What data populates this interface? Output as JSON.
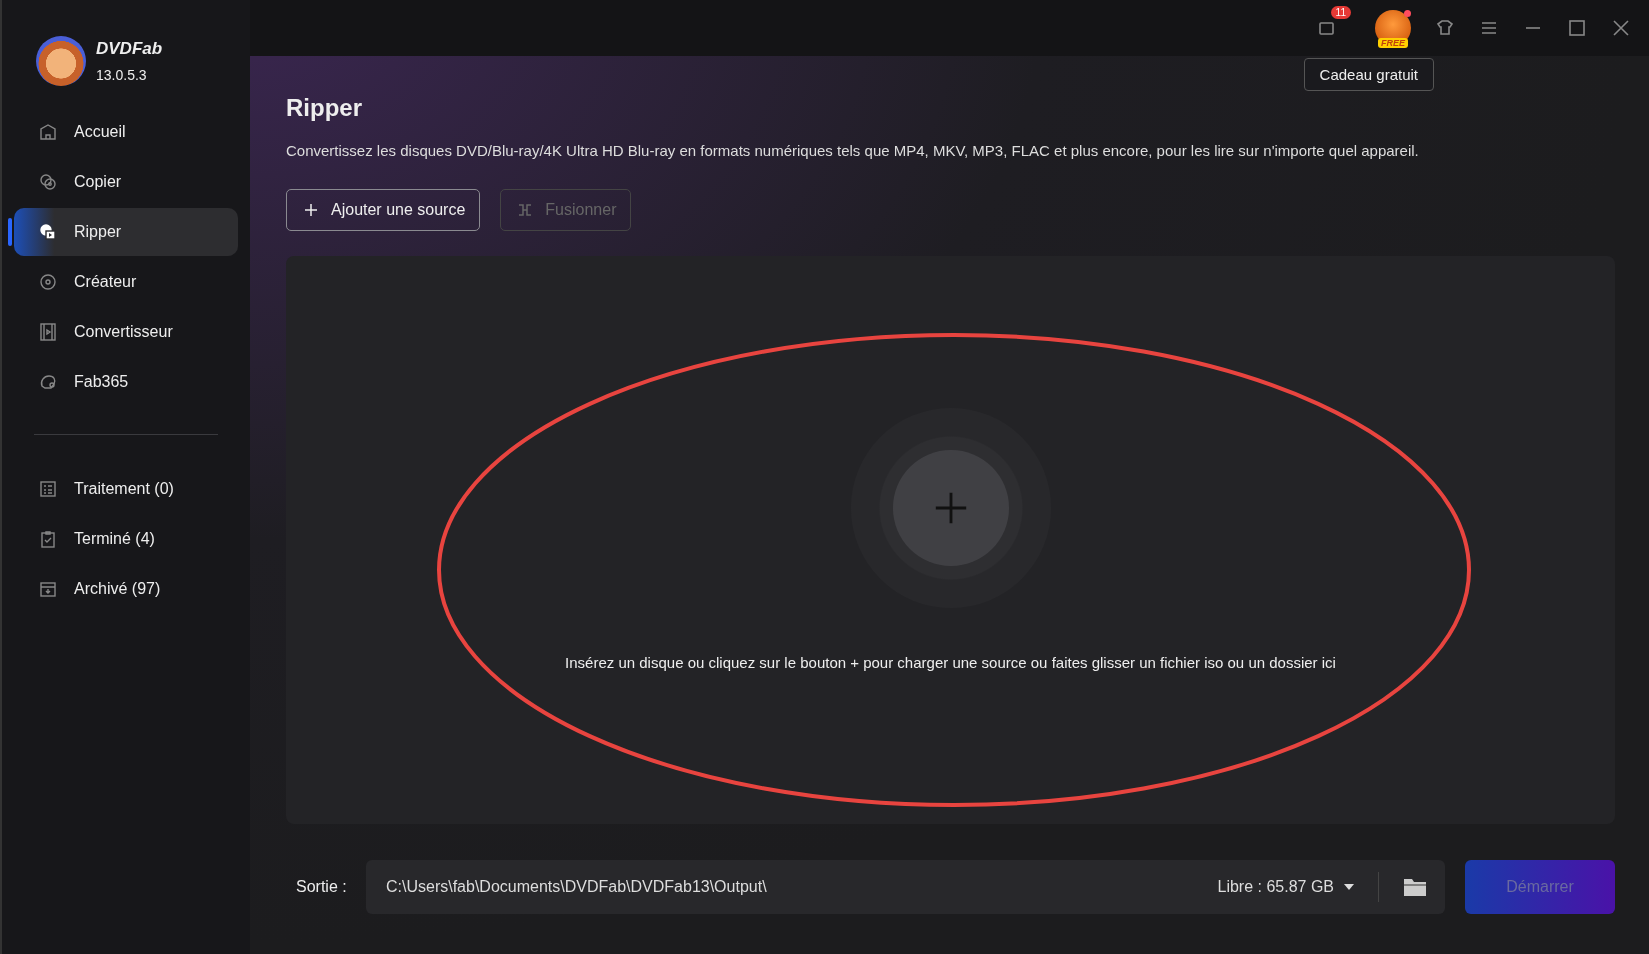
{
  "app": {
    "name": "DVDFab",
    "version": "13.0.5.3"
  },
  "titlebar": {
    "notification_count": "11",
    "free_label": "FREE",
    "tooltip": "Cadeau gratuit"
  },
  "sidebar": {
    "items": [
      {
        "label": "Accueil",
        "selected": false
      },
      {
        "label": "Copier",
        "selected": false
      },
      {
        "label": "Ripper",
        "selected": true
      },
      {
        "label": "Créateur",
        "selected": false
      },
      {
        "label": "Convertisseur",
        "selected": false
      },
      {
        "label": "Fab365",
        "selected": false
      }
    ],
    "queue": [
      {
        "label": "Traitement (0)",
        "selected": false
      },
      {
        "label": "Terminé (4)",
        "selected": false
      },
      {
        "label": "Archivé (97)",
        "selected": false
      }
    ]
  },
  "page": {
    "title": "Ripper",
    "description": "Convertissez les disques DVD/Blu-ray/4K Ultra HD Blu-ray en formats numériques tels que MP4, MKV, MP3, FLAC et plus encore, pour les lire sur n'importe quel appareil.",
    "buttons": [
      {
        "label": "Ajouter une source",
        "kind": "add",
        "disabled": false
      },
      {
        "label": "Fusionner",
        "kind": "merge",
        "disabled": true
      }
    ],
    "drop_hint": "Insérez un disque ou cliquez sur le bouton +  pour charger une source ou faites glisser un fichier iso ou un dossier ici"
  },
  "output": {
    "label": "Sortie :",
    "path": "C:\\Users\\fab\\Documents\\DVDFab\\DVDFab13\\Output\\",
    "free_space": "Libre : 65.87 GB",
    "start": {
      "label": "Démarrer",
      "disabled": true
    }
  }
}
